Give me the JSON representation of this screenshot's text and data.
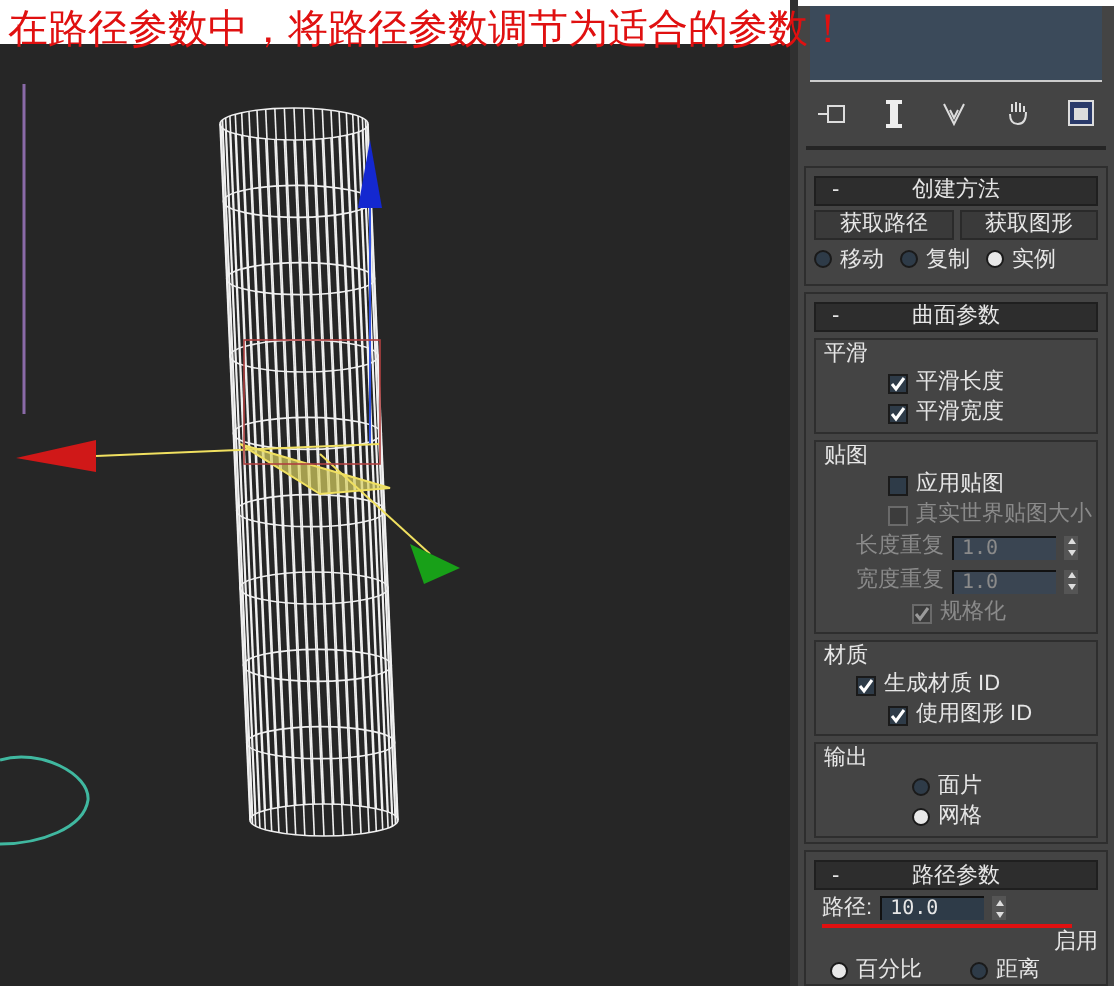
{
  "caption": "在路径参数中，将路径参数调节为适合的参数！",
  "creation_method": {
    "collapse": "-",
    "title": "创建方法",
    "buttons": [
      "获取路径",
      "获取图形"
    ],
    "radios": [
      {
        "label": "移动",
        "selected": false
      },
      {
        "label": "复制",
        "selected": false
      },
      {
        "label": "实例",
        "selected": true
      }
    ]
  },
  "surface_parameters": {
    "collapse": "-",
    "title": "曲面参数",
    "smoothing": {
      "title": "平滑",
      "checkboxes": [
        {
          "label": "平滑长度",
          "checked": true,
          "disabled": false
        },
        {
          "label": "平滑宽度",
          "checked": true,
          "disabled": false
        }
      ]
    },
    "mapping": {
      "title": "贴图",
      "checkboxes": [
        {
          "label": "应用贴图",
          "checked": false,
          "disabled": false
        },
        {
          "label": "真实世界贴图大小",
          "checked": false,
          "disabled": true
        }
      ],
      "spinners": [
        {
          "label": "长度重复",
          "value": "1.0",
          "disabled": true
        },
        {
          "label": "宽度重复",
          "value": "1.0",
          "disabled": true
        }
      ],
      "normalize": {
        "label": "规格化",
        "checked": true,
        "disabled": true
      }
    },
    "material": {
      "title": "材质",
      "checkboxes": [
        {
          "label": "生成材质 ID",
          "checked": true,
          "disabled": false
        },
        {
          "label": "使用图形 ID",
          "checked": true,
          "disabled": false
        }
      ]
    },
    "output": {
      "title": "输出",
      "radios": [
        {
          "label": "面片",
          "selected": false
        },
        {
          "label": "网格",
          "selected": true
        }
      ]
    }
  },
  "path_parameters": {
    "collapse": "-",
    "title": "路径参数",
    "spinner": {
      "label": "路径:",
      "value": "10.0"
    },
    "enable_label": "启用",
    "radios": [
      {
        "label": "百分比",
        "selected": true
      },
      {
        "label": "距离",
        "selected": false
      }
    ]
  }
}
